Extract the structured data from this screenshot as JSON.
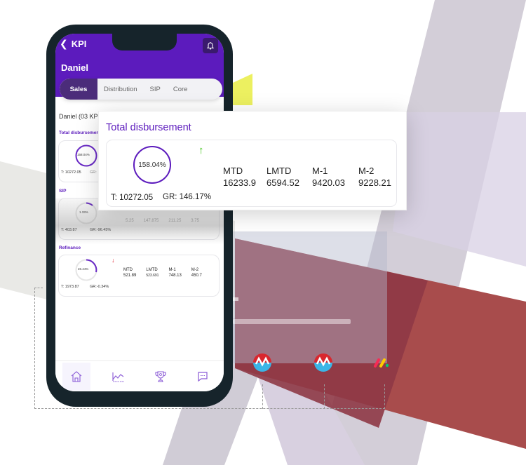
{
  "app": {
    "header": {
      "back_label": "KPI",
      "user_name": "Daniel",
      "bell_icon": "bell-icon"
    },
    "tabs": [
      {
        "label": "Sales",
        "active": true
      },
      {
        "label": "Distribution",
        "active": false
      },
      {
        "label": "SIP",
        "active": false
      },
      {
        "label": "Core",
        "active": false
      }
    ],
    "section_intro": "Daniel (03 KPI",
    "kpis": [
      {
        "label": "Total disbursement",
        "label_truncated": "Total disbursemen",
        "ring_value": "158.04%",
        "ring_progress": 1.0,
        "target": "T: 10272.05",
        "growth": "GR: 146.17%",
        "growth_short": "GR:",
        "trend": "up",
        "metrics": [
          {
            "label": "MTD",
            "value": "16233.9"
          },
          {
            "label": "LMTD",
            "value": "6594.52"
          },
          {
            "label": "M-1",
            "value": "9420.03"
          },
          {
            "label": "M-2",
            "value": "9228.21"
          }
        ]
      },
      {
        "label": "SIP",
        "ring_value": "1.33%",
        "ring_progress": 0.0133,
        "target": "T: 403.87",
        "growth": "GR:-96.45%",
        "trend": "down",
        "metrics": [
          {
            "label": "MTD",
            "value": "5.25"
          },
          {
            "label": "LMTD",
            "value": "147.875"
          },
          {
            "label": "M-1",
            "value": "211.25"
          },
          {
            "label": "M-2",
            "value": "3.75"
          }
        ]
      },
      {
        "label": "Refinance",
        "ring_value": "26.44%",
        "ring_progress": 0.2644,
        "target": "T: 1973.87",
        "growth": "GR:-0.34%",
        "trend": "down",
        "metrics": [
          {
            "label": "MTD",
            "value": "521.89"
          },
          {
            "label": "LMTD",
            "value": "523.691"
          },
          {
            "label": "M-1",
            "value": "748.13"
          },
          {
            "label": "M-2",
            "value": "450.7"
          }
        ]
      }
    ],
    "bottom_nav": [
      {
        "name": "home",
        "icon": "home-icon",
        "active": true
      },
      {
        "name": "analytics",
        "icon": "line-chart-icon",
        "active": false
      },
      {
        "name": "rewards",
        "icon": "trophy-icon",
        "active": false
      },
      {
        "name": "messages",
        "icon": "chat-icon",
        "active": false
      }
    ]
  },
  "float_card": {
    "title": "Total disbursement",
    "ring_value": "158.04%",
    "target": "T: 10272.05",
    "growth": "GR: 146.17%",
    "trend_icon": "↑",
    "metrics": [
      {
        "label": "MTD",
        "value": "16233.9"
      },
      {
        "label": "LMTD",
        "value": "6594.52"
      },
      {
        "label": "M-1",
        "value": "9420.03"
      },
      {
        "label": "M-2",
        "value": "9228.21"
      }
    ]
  },
  "integrations": [
    {
      "name": "m-logo-1",
      "icon": "red-blue-m-logo"
    },
    {
      "name": "m-logo-2",
      "icon": "red-blue-m-logo"
    },
    {
      "name": "monday-logo",
      "icon": "monday-logo"
    }
  ],
  "colors": {
    "brand_purple": "#5c1bbd",
    "tab_active": "#4b2c7a",
    "phone_frame": "#16242b",
    "trend_up": "#3ac30f",
    "trend_down": "#e0202a",
    "accent_red": "#a84c4c",
    "accent_yellow": "#ecf060"
  }
}
